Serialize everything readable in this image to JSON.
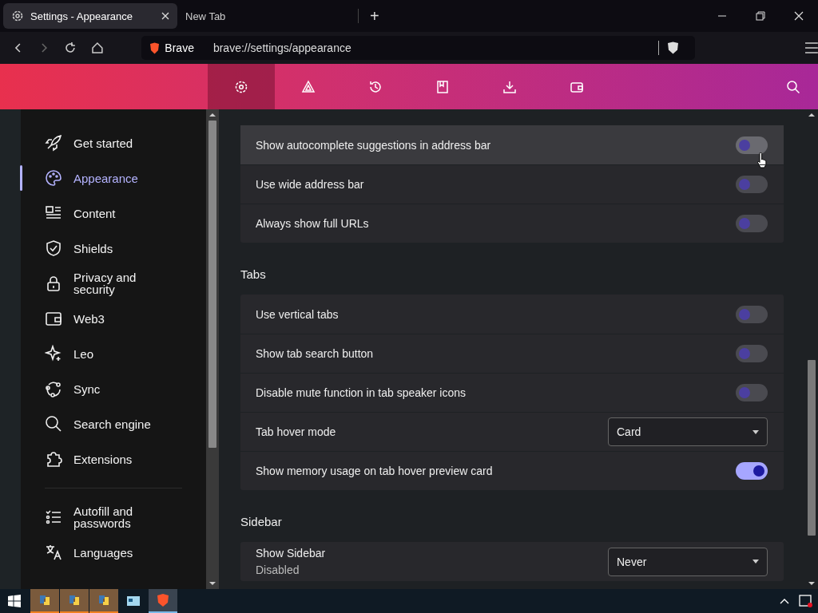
{
  "browser_tabs": [
    {
      "title": "Settings - Appearance",
      "selected": true
    },
    {
      "title": "New Tab",
      "selected": false
    }
  ],
  "new_tab_button": "+",
  "address_bar": {
    "site_label": "Brave",
    "url": "brave://settings/appearance"
  },
  "toolbar": [
    {
      "selected": true
    },
    {
      "selected": false
    },
    {
      "selected": false
    },
    {
      "selected": false
    },
    {
      "selected": false
    },
    {
      "selected": false
    }
  ],
  "sidebar": {
    "items": [
      {
        "label": "Get started",
        "selected": false
      },
      {
        "label": "Appearance",
        "selected": true
      },
      {
        "label": "Content",
        "selected": false
      },
      {
        "label": "Shields",
        "selected": false
      },
      {
        "label": "Privacy and security",
        "selected": false
      },
      {
        "label": "Web3",
        "selected": false
      },
      {
        "label": "Leo",
        "selected": false
      },
      {
        "label": "Sync",
        "selected": false
      },
      {
        "label": "Search engine",
        "selected": false
      },
      {
        "label": "Extensions",
        "selected": false
      }
    ],
    "more_items": [
      {
        "label": "Autofill and passwords",
        "selected": false
      },
      {
        "label": "Languages",
        "selected": false
      }
    ]
  },
  "sections": [
    {
      "rows": [
        {
          "kind": "toggle",
          "label": "Show autocomplete suggestions in address bar",
          "on": false,
          "hovered": true
        },
        {
          "kind": "toggle",
          "label": "Use wide address bar",
          "on": false,
          "hovered": false
        },
        {
          "kind": "toggle",
          "label": "Always show full URLs",
          "on": false,
          "hovered": false
        }
      ]
    },
    {
      "title": "Tabs",
      "rows": [
        {
          "kind": "toggle",
          "label": "Use vertical tabs",
          "on": false,
          "hovered": false
        },
        {
          "kind": "toggle",
          "label": "Show tab search button",
          "on": false,
          "hovered": false
        },
        {
          "kind": "toggle",
          "label": "Disable mute function in tab speaker icons",
          "on": false,
          "hovered": false
        },
        {
          "kind": "select",
          "label": "Tab hover mode",
          "value": "Card",
          "hovered": false
        },
        {
          "kind": "toggle",
          "label": "Show memory usage on tab hover preview card",
          "on": true,
          "hovered": false
        }
      ]
    },
    {
      "title": "Sidebar",
      "rows": [
        {
          "kind": "select",
          "label": "Show Sidebar",
          "sublabel": "Disabled",
          "value": "Never",
          "hovered": false
        }
      ]
    }
  ],
  "taskbar": [
    {
      "active": false
    },
    {
      "active": false
    },
    {
      "active": false
    },
    {
      "active": false
    },
    {
      "active": true
    }
  ]
}
